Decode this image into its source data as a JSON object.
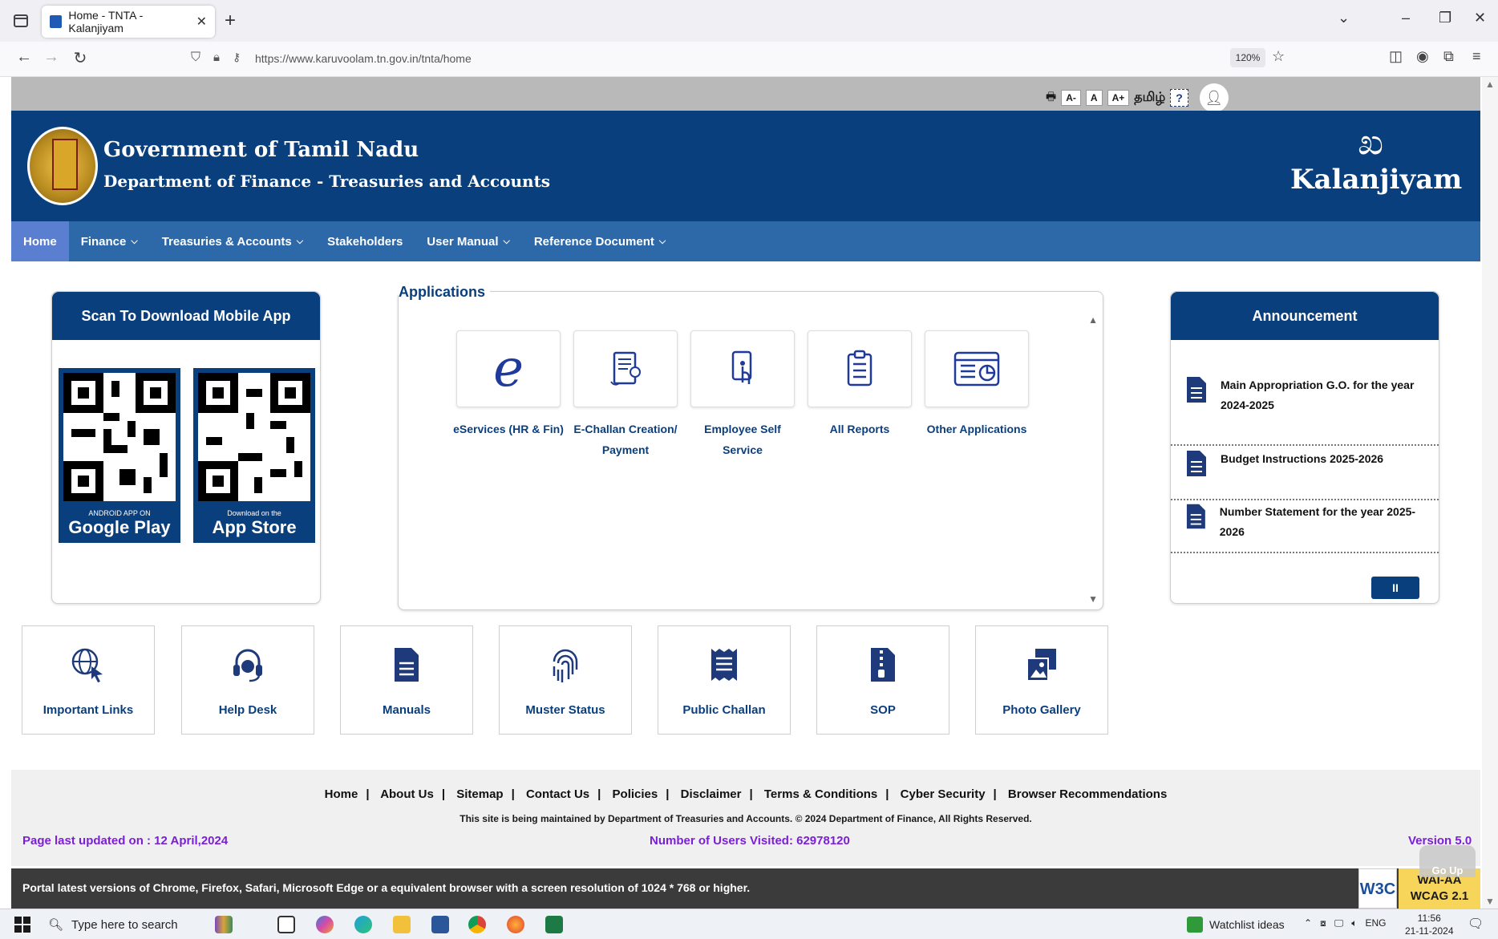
{
  "browser": {
    "tab_title": "Home - TNTA - Kalanjiyam",
    "url": "https://www.karuvoolam.tn.gov.in/tnta/home",
    "zoom": "120%"
  },
  "utility": {
    "font_decrease": "A-",
    "font_normal": "A",
    "font_increase": "A+",
    "language": "தமிழ்",
    "help": "?"
  },
  "header": {
    "gov_title": "Government of Tamil Nadu",
    "dept_title": "Department of Finance - Treasuries and Accounts",
    "brand_mark": "ಖ",
    "brand_name": "Kalanjiyam"
  },
  "nav": {
    "items": [
      {
        "label": "Home",
        "active": true,
        "dropdown": false
      },
      {
        "label": "Finance",
        "active": false,
        "dropdown": true
      },
      {
        "label": "Treasuries & Accounts",
        "active": false,
        "dropdown": true
      },
      {
        "label": "Stakeholders",
        "active": false,
        "dropdown": false
      },
      {
        "label": "User Manual",
        "active": false,
        "dropdown": true
      },
      {
        "label": "Reference Document",
        "active": false,
        "dropdown": true
      }
    ]
  },
  "mobile": {
    "title": "Scan To Download Mobile App",
    "android_small": "ANDROID APP ON",
    "android_big": "Google Play",
    "ios_small": "Download on the",
    "ios_big": "App Store"
  },
  "applications": {
    "title": "Applications",
    "items": [
      {
        "label_line1": "eServices (HR & Fin)",
        "label_line2": "",
        "icon": "e-letter-icon"
      },
      {
        "label_line1": "E-Challan Creation/",
        "label_line2": "Payment",
        "icon": "challan-scroll-icon"
      },
      {
        "label_line1": "Employee Self",
        "label_line2": "Service",
        "icon": "touch-phone-icon"
      },
      {
        "label_line1": "All Reports",
        "label_line2": "",
        "icon": "clipboard-list-icon"
      },
      {
        "label_line1": "Other Applications",
        "label_line2": "",
        "icon": "browser-chart-icon"
      }
    ]
  },
  "announcement": {
    "title": "Announcement",
    "items": [
      {
        "line1": "Main Appropriation G.O. for the year",
        "line2": "2024-2025"
      },
      {
        "line1": "Budget Instructions 2025-2026",
        "line2": ""
      },
      {
        "line1": "Number Statement for the year 2025-2026",
        "line2": ""
      }
    ],
    "pause": "II"
  },
  "quick_links": [
    {
      "label": "Important Links",
      "icon": "globe-cursor-icon"
    },
    {
      "label": "Help Desk",
      "icon": "headset-icon"
    },
    {
      "label": "Manuals",
      "icon": "document-icon"
    },
    {
      "label": "Muster Status",
      "icon": "fingerprint-icon"
    },
    {
      "label": "Public Challan",
      "icon": "receipt-icon"
    },
    {
      "label": "SOP",
      "icon": "zip-file-icon"
    },
    {
      "label": "Photo Gallery",
      "icon": "photos-icon"
    }
  ],
  "footer": {
    "links": [
      "Home",
      "About Us",
      "Sitemap",
      "Contact Us",
      "Policies",
      "Disclaimer",
      "Terms & Conditions",
      "Cyber Security",
      "Browser Recommendations"
    ],
    "copyright": "This site is being maintained by Department of Treasuries and Accounts. © 2024 Department of Finance, All Rights Reserved.",
    "last_updated": "Page last updated on : 12 April,2024",
    "visitors": "Number of Users Visited: 62978120",
    "version": "Version 5.0",
    "browser_note": "Portal latest versions of Chrome, Firefox, Safari, Microsoft Edge or a equivalent browser with a screen resolution of 1024 * 768 or higher.",
    "w3c": "W3C",
    "wcag_line1": "WAI-AA",
    "wcag_line2": "WCAG 2.1",
    "go_up": "Go Up"
  },
  "taskbar": {
    "search_placeholder": "Type here to search",
    "watchlist": "Watchlist ideas",
    "lang": "ENG",
    "time": "11:56",
    "date": "21-11-2024"
  },
  "colors": {
    "brand_blue": "#0a3f7e",
    "nav_blue": "#2d68a8",
    "footer_purple": "#7b1fd6"
  }
}
